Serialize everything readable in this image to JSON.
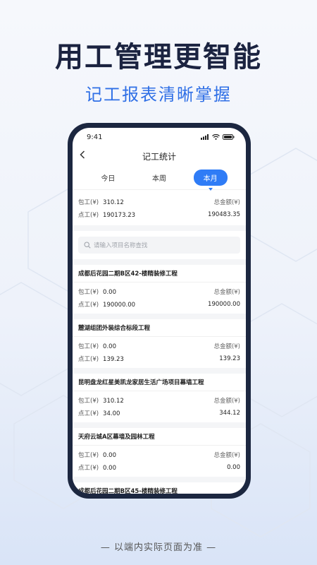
{
  "headline": "用工管理更智能",
  "subline": "记工报表清晰掌握",
  "footer": "— 以端内实际页面为准 —",
  "status_bar": {
    "time": "9:41"
  },
  "nav": {
    "title": "记工统计"
  },
  "tabs": [
    {
      "label": "今日",
      "active": false
    },
    {
      "label": "本周",
      "active": false
    },
    {
      "label": "本月",
      "active": true
    }
  ],
  "summary": {
    "baogong_label": "包工(¥)",
    "baogong_value": "310.12",
    "diangong_label": "点工(¥)",
    "diangong_value": "190173.23",
    "total_label": "总金额(¥)",
    "total_value": "190483.35"
  },
  "search": {
    "placeholder": "请输入项目名称查找"
  },
  "projects": [
    {
      "name": "成都后花园二期B区42-楼精装修工程",
      "baogong_label": "包工(¥)",
      "baogong": "0.00",
      "diangong_label": "点工(¥)",
      "diangong": "190000.00",
      "total_label": "总金额(¥)",
      "total": "190000.00"
    },
    {
      "name": "麓湖组团外装综合标段工程",
      "baogong_label": "包工(¥)",
      "baogong": "0.00",
      "diangong_label": "点工(¥)",
      "diangong": "139.23",
      "total_label": "总金额(¥)",
      "total": "139.23"
    },
    {
      "name": "昆明盘龙红星美凯龙家居生活广场项目幕墙工程",
      "baogong_label": "包工(¥)",
      "baogong": "310.12",
      "diangong_label": "点工(¥)",
      "diangong": "34.00",
      "total_label": "总金额(¥)",
      "total": "344.12"
    },
    {
      "name": "天府云城A区幕墙及园林工程",
      "baogong_label": "包工(¥)",
      "baogong": "0.00",
      "diangong_label": "点工(¥)",
      "diangong": "0.00",
      "total_label": "总金额(¥)",
      "total": "0.00"
    },
    {
      "name": "成都后花园二期B区45-楼精装修工程"
    }
  ],
  "colors": {
    "accent": "#2f7cf6",
    "headline": "#1b2340",
    "subline": "#2f6fe6",
    "phone_frame": "#1c2740"
  },
  "icons": {
    "back": "chevron-left-icon",
    "search": "search-icon",
    "signal": "signal-icon",
    "wifi": "wifi-icon",
    "battery": "battery-icon"
  }
}
